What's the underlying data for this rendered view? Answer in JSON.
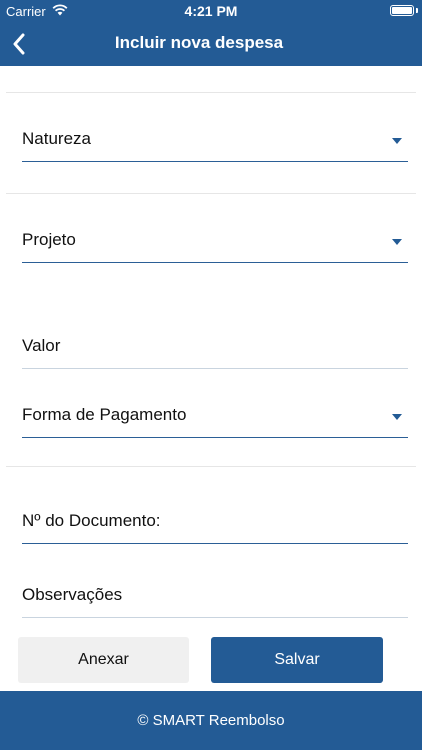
{
  "status_bar": {
    "carrier": "Carrier",
    "time": "4:21 PM",
    "battery_level": 1.0
  },
  "nav": {
    "title": "Incluir nova despesa",
    "back_icon": "chevron-left-icon"
  },
  "form": {
    "fields": [
      {
        "label": "Natureza",
        "type": "dropdown"
      },
      {
        "label": "Projeto",
        "type": "dropdown"
      },
      {
        "label": "Valor",
        "type": "text"
      },
      {
        "label": "Forma de Pagamento",
        "type": "dropdown"
      },
      {
        "label": "Nº do Documento:",
        "type": "text"
      },
      {
        "label": "Observações",
        "type": "text"
      }
    ]
  },
  "buttons": {
    "attach_label": "Anexar",
    "save_label": "Salvar"
  },
  "footer": {
    "text": "© SMART Reembolso"
  },
  "colors": {
    "primary": "#235b95",
    "secondary_button": "#f0f0f0",
    "text": "#111111",
    "separator": "#e6e6e6"
  }
}
